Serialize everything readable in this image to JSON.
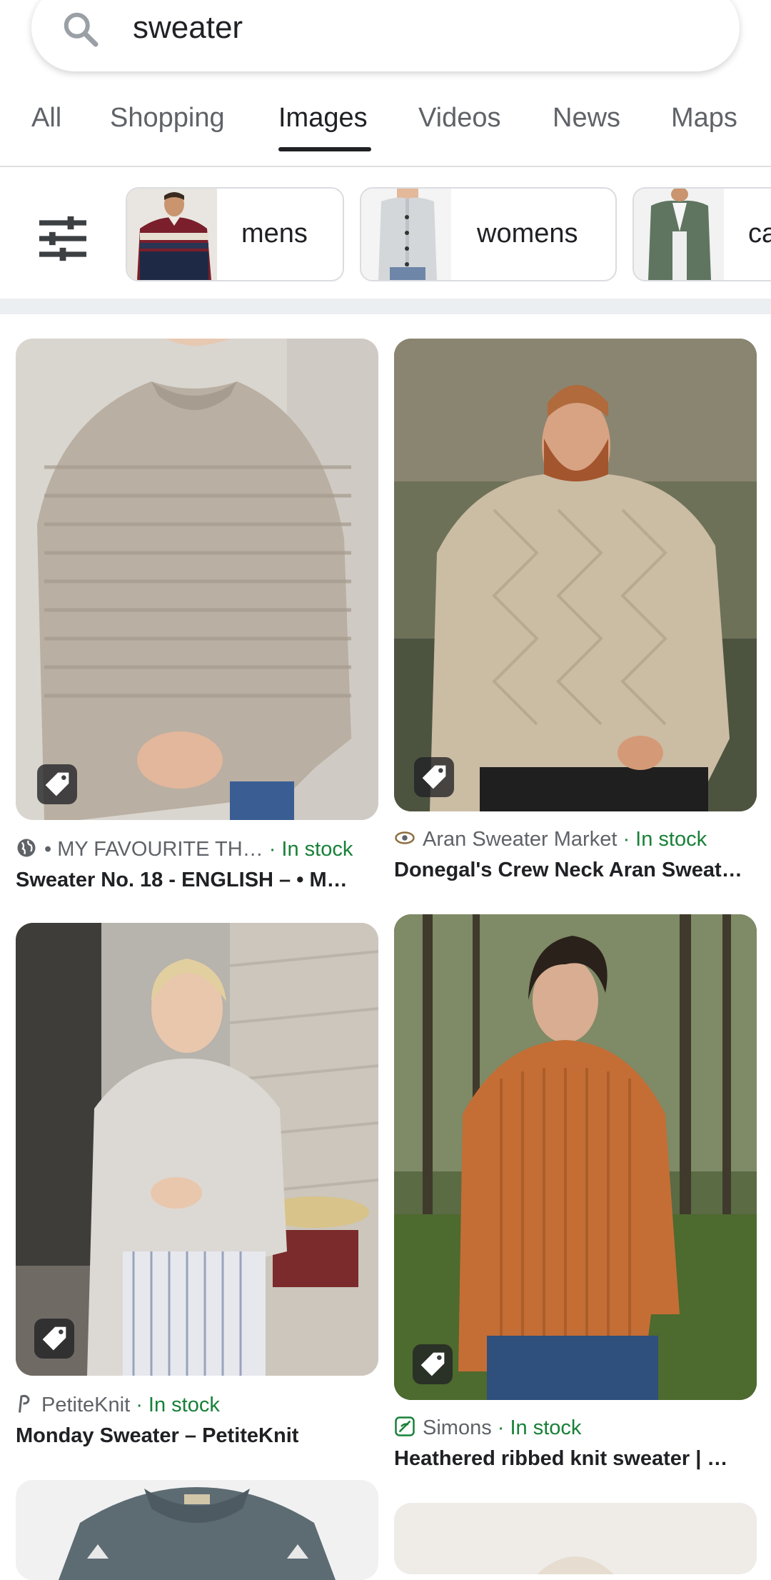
{
  "search": {
    "query": "sweater"
  },
  "tabs": [
    {
      "label": "All"
    },
    {
      "label": "Shopping"
    },
    {
      "label": "Images"
    },
    {
      "label": "Videos"
    },
    {
      "label": "News"
    },
    {
      "label": "Maps"
    }
  ],
  "active_tab": "Images",
  "chips": [
    {
      "label": "mens"
    },
    {
      "label": "womens"
    },
    {
      "label": "ca"
    }
  ],
  "results": [
    {
      "source": "• MY FAVOURITE TH…",
      "stock": "· In stock",
      "title": "Sweater No. 18 - ENGLISH – • M…",
      "favicon": "globe-icon"
    },
    {
      "source": "Aran Sweater Market",
      "stock": "· In stock",
      "title": "Donegal's Crew Neck Aran Sweat…",
      "favicon": "eye-logo-icon"
    },
    {
      "source": "PetiteKnit",
      "stock": "· In stock",
      "title": "Monday Sweater – PetiteKnit",
      "favicon": "petiteknit-logo-icon"
    },
    {
      "source": "Simons",
      "stock": "· In stock",
      "title": "Heathered ribbed knit sweater | …",
      "favicon": "simons-logo-icon"
    }
  ],
  "colors": {
    "in_stock": "#188038",
    "active_tab": "#202124",
    "inactive_tab": "#5f6368"
  }
}
